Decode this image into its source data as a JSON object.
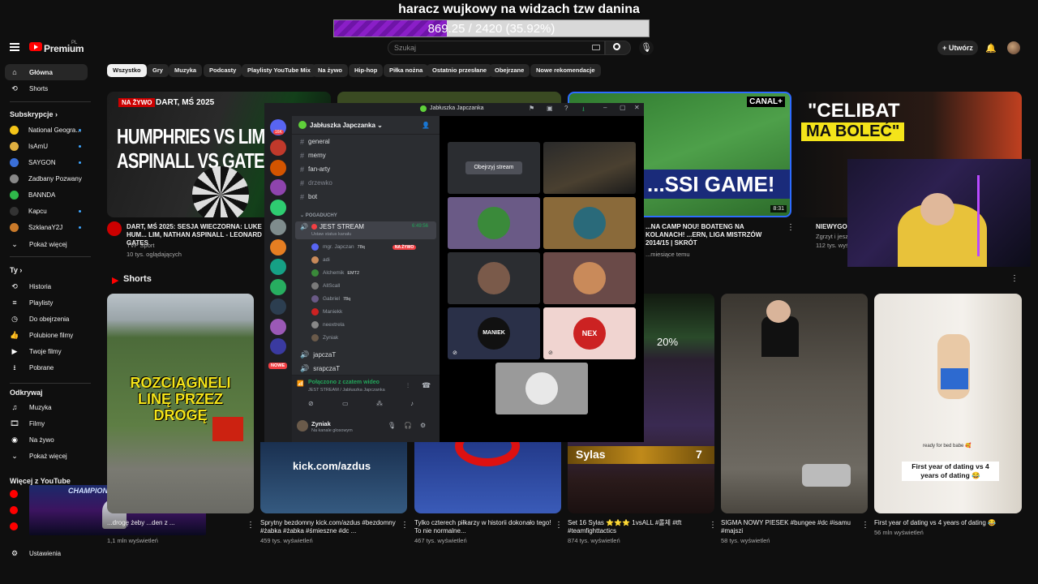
{
  "overlay": {
    "title": "haracz wujkowy na widzach tzw danina",
    "progress_text": "869.25 / 2420 (35.92%)",
    "progress_fraction": 0.3592
  },
  "header": {
    "brand": "Premium",
    "brand_sup": "PL",
    "search_placeholder": "Szukaj",
    "create_label": "Utwórz"
  },
  "sidebar": {
    "main": [
      {
        "label": "Główna",
        "icon": "home-icon"
      },
      {
        "label": "Shorts",
        "icon": "shorts-icon"
      }
    ],
    "subs_title": "Subskrypcje",
    "subs": [
      {
        "label": "National Geogra...",
        "color": "#f5c518"
      },
      {
        "label": "IsAmU",
        "color": "#e0b040"
      },
      {
        "label": "SAYGON",
        "color": "#3a6fd8"
      },
      {
        "label": "Zadbany Pozwany",
        "color": "#888888"
      },
      {
        "label": "BANNDA",
        "color": "#2fb84a"
      },
      {
        "label": "Kapcu",
        "color": "#333333"
      },
      {
        "label": "SzklanaY2J",
        "color": "#c97a2a"
      }
    ],
    "subs_more": "Pokaż więcej",
    "you_title": "Ty",
    "you": [
      {
        "label": "Historia",
        "icon": "history-icon"
      },
      {
        "label": "Playlisty",
        "icon": "playlist-icon"
      },
      {
        "label": "Do obejrzenia",
        "icon": "watch-later-icon"
      },
      {
        "label": "Polubione filmy",
        "icon": "like-icon"
      },
      {
        "label": "Twoje filmy",
        "icon": "your-videos-icon"
      },
      {
        "label": "Pobrane",
        "icon": "download-icon"
      }
    ],
    "explore_title": "Odkrywaj",
    "explore": [
      {
        "label": "Muzyka",
        "icon": "music-icon"
      },
      {
        "label": "Filmy",
        "icon": "film-icon"
      },
      {
        "label": "Na żywo",
        "icon": "live-icon"
      },
      {
        "label": "Pokaż więcej",
        "icon": "chevron-down-icon"
      }
    ],
    "more_title": "Więcej z YouTube",
    "settings": "Ustawienia"
  },
  "chips": [
    "Wszystko",
    "Gry",
    "Muzyka",
    "Podcasty",
    "Playlisty YouTube Mix",
    "Na żywo",
    "Hip-hop",
    "Piłka nożna",
    "Ostatnio przesłane",
    "Obejrzane",
    "Nowe rekomendacje"
  ],
  "videos": [
    {
      "title": "DART, MŚ 2025: SESJA WIECZORNA: LUKE HUM... LIM, NATHAN ASPINALL - LEONARD GATES",
      "channel": "TVP Sport",
      "meta": "10 tys. oglądających",
      "badge": "NA ŻYWO",
      "thumb_title": "DART, MŚ 2025",
      "thumb_l1": "HUMPHRIES VS LIM",
      "thumb_l2": "ASPINALL VS GATES"
    },
    {
      "title": "...NA CAMP NOU! BOATENG NA KOLANACH! ...ERN, LIGA MISTRZÓW 2014/15 | SKRÓT",
      "meta": "...miesiące temu",
      "thumb_text": "...SSI GAME!",
      "duration": "8:31",
      "logo": "CANAL+"
    },
    {
      "title": "NIEWYGOD...",
      "channel": "Zgrzyt i jesz...",
      "meta": "112 tys. wyś...",
      "thumb_l1": "\"CELIBAT",
      "thumb_l2": "MA BOLEĆ\""
    }
  ],
  "shorts_title": "Shorts",
  "shorts": [
    {
      "title": "...drogę żeby ...den z ...",
      "meta": "1,1 mln wyświetleń",
      "thumb_text": "ROZCIĄGNELI LINĘ PRZEZ DROGĘ"
    },
    {
      "title": "Sprytny bezdomny kick.com/azdus #bezdomny #żabka #żabka #śmieszne #dc ...",
      "meta": "459 tys. wyświetleń",
      "thumb_text": "kick.com/azdus"
    },
    {
      "title": "Tylko czterech piłkarzy w historii dokonało tego! To nie normalne...",
      "meta": "467 tys. wyświetleń"
    },
    {
      "title": "Set 16 Sylas ⭐⭐⭐ 1vsALL #롤체 #tft #teamfighttactics",
      "meta": "874 tys. wyświetleń",
      "thumb_text": "Sylas",
      "num": "7",
      "pct": "20%"
    },
    {
      "title": "SIGMA NOWY PIESEK #bungee #dc #isamu #majszi",
      "meta": "58 tys. wyświetleń"
    },
    {
      "title": "First year of dating vs 4 years of dating 😂",
      "meta": "56 mln wyświetleń",
      "caption": "First year of dating vs 4 years of dating 😂",
      "caption2": "ready for bed babe 🥰"
    }
  ],
  "discord": {
    "window_title": "Jabłuszka Japczanka",
    "server": "Jabłuszka Japczanka",
    "channels": [
      "general",
      "memy",
      "fan-arty",
      "drzewko",
      "bot"
    ],
    "category": "POGADUCHY",
    "voice_channel": "JEST STREAM",
    "voice_time": "6:49:56",
    "voice_status": "Ustaw status kanału",
    "users": [
      {
        "name": "mgr. Japczan",
        "tag": "78q",
        "live": "NA ŻYWO"
      },
      {
        "name": "adi"
      },
      {
        "name": "Alchemik",
        "tag": "EMT2"
      },
      {
        "name": "AllScall"
      },
      {
        "name": "Gabriel",
        "tag": "78q"
      },
      {
        "name": "Maniekk"
      },
      {
        "name": "neextrela"
      },
      {
        "name": "Zyniak"
      }
    ],
    "voice2": "japczaT",
    "voice3": "srapczaT",
    "connected": "Połączono z czatem wideo",
    "connected_sub": "JEST STREAM / Jabłuszka Japczanka",
    "me": "Zyniak",
    "me_status": "Na kanale głosowym",
    "watch_label": "Obejrzyj stream",
    "new_badge": "NOWE",
    "guild_badge": "16K",
    "tile_label": "MANIEK",
    "tile_label2": "NEX"
  },
  "colors": {
    "accent": "#ff0000",
    "live": "#cc0000",
    "discord_green": "#23a55a",
    "blurple": "#5865f2",
    "progress_purple": "#8a1ec7"
  }
}
